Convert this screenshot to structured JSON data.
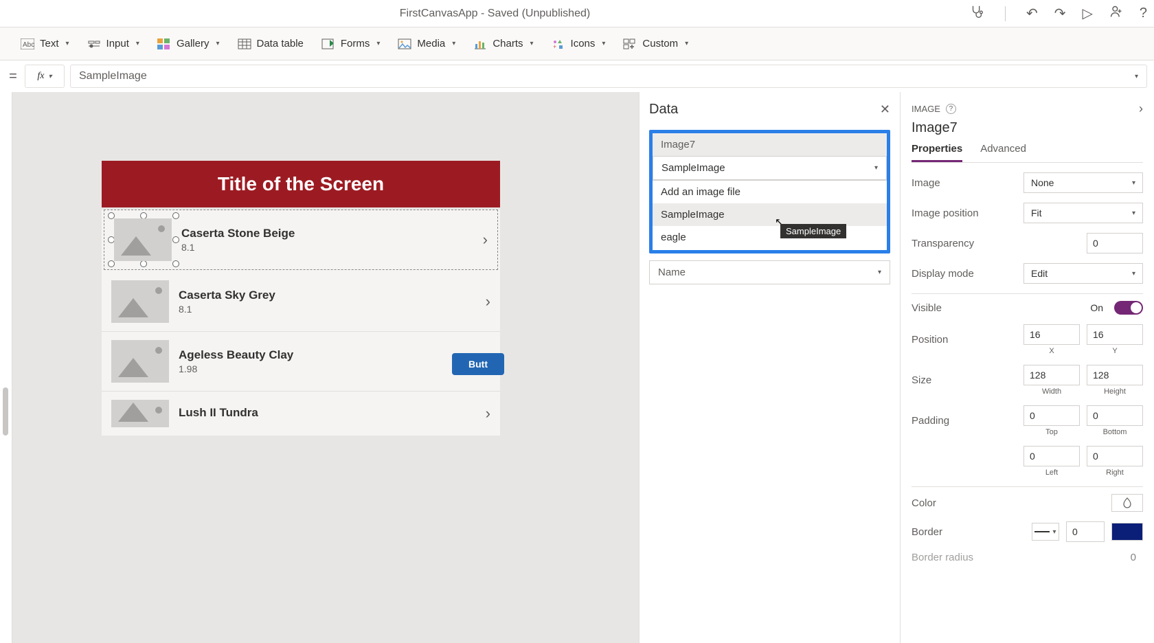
{
  "titlebar": {
    "title": "FirstCanvasApp - Saved (Unpublished)"
  },
  "ribbon": {
    "text": "Text",
    "input": "Input",
    "gallery": "Gallery",
    "datatable": "Data table",
    "forms": "Forms",
    "media": "Media",
    "charts": "Charts",
    "icons": "Icons",
    "custom": "Custom"
  },
  "formula": {
    "value": "SampleImage"
  },
  "screen": {
    "title": "Title of the Screen",
    "button": "Butt",
    "items": [
      {
        "title": "Caserta Stone Beige",
        "sub": "8.1"
      },
      {
        "title": "Caserta Sky Grey",
        "sub": "8.1"
      },
      {
        "title": "Ageless Beauty Clay",
        "sub": "1.98"
      },
      {
        "title": "Lush II Tundra",
        "sub": ""
      }
    ]
  },
  "datapanel": {
    "title": "Data",
    "item_label": "Image7",
    "selected": "SampleImage",
    "options": [
      "Add an image file",
      "SampleImage",
      "eagle"
    ],
    "tooltip": "SampleImage",
    "name_label": "Name"
  },
  "props": {
    "type": "IMAGE",
    "name": "Image7",
    "tabs": {
      "properties": "Properties",
      "advanced": "Advanced"
    },
    "image_label": "Image",
    "image_value": "None",
    "imagepos_label": "Image position",
    "imagepos_value": "Fit",
    "trans_label": "Transparency",
    "trans_value": "0",
    "display_label": "Display mode",
    "display_value": "Edit",
    "visible_label": "Visible",
    "visible_value": "On",
    "position_label": "Position",
    "pos_x": "16",
    "pos_y": "16",
    "x_label": "X",
    "y_label": "Y",
    "size_label": "Size",
    "width": "128",
    "height": "128",
    "w_label": "Width",
    "h_label": "Height",
    "padding_label": "Padding",
    "pad_t": "0",
    "pad_b": "0",
    "pad_l": "0",
    "pad_r": "0",
    "t_label": "Top",
    "b_label": "Bottom",
    "l_label": "Left",
    "r_label": "Right",
    "color_label": "Color",
    "border_label": "Border",
    "border_value": "0",
    "radius_label": "Border radius",
    "radius_value": "0"
  }
}
